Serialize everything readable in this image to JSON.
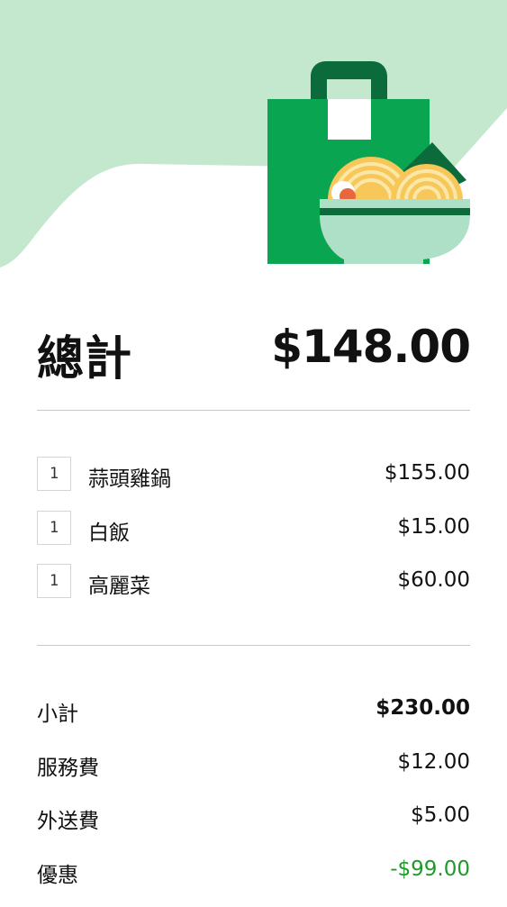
{
  "colors": {
    "hero_bg": "#c3e8cd",
    "bag_green": "#0aa551",
    "bag_dark_green": "#0b6b3a",
    "bowl": "#aee0c8",
    "noodle": "#f7c75a",
    "egg": "#e8673c",
    "discount_green": "#1f9a2a"
  },
  "hero": {
    "icon": "takeout-bag-noodle-bowl-illustration"
  },
  "total": {
    "label": "總計",
    "value": "$148.00"
  },
  "items": [
    {
      "qty": "1",
      "name": "蒜頭雞鍋",
      "price": "$155.00"
    },
    {
      "qty": "1",
      "name": "白飯",
      "price": "$15.00"
    },
    {
      "qty": "1",
      "name": "高麗菜",
      "price": "$60.00"
    }
  ],
  "summary": {
    "subtotal_label": "小計",
    "subtotal_value": "$230.00",
    "service_fee_label": "服務費",
    "service_fee_value": "$12.00",
    "delivery_fee_label": "外送費",
    "delivery_fee_value": "$5.00",
    "discount_label": "優惠",
    "discount_value": "-$99.00"
  }
}
